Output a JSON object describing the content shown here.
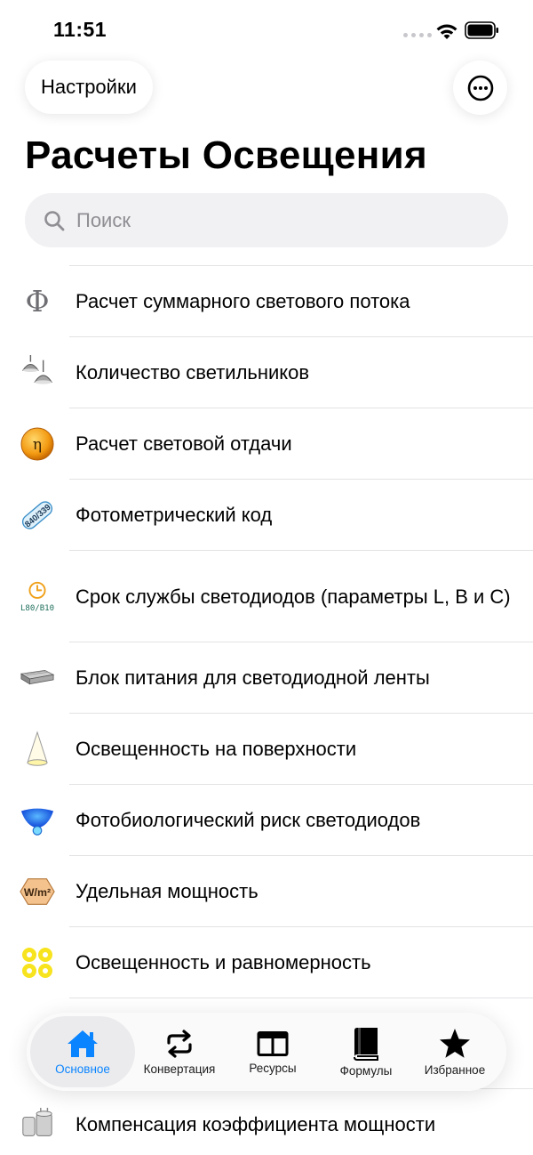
{
  "status_bar": {
    "time": "11:51"
  },
  "header": {
    "settings_label": "Настройки",
    "title": "Расчеты Освещения"
  },
  "search": {
    "placeholder": "Поиск"
  },
  "items": [
    {
      "label": "Расчет суммарного светового потока",
      "icon": "phi-icon"
    },
    {
      "label": "Количество светильников",
      "icon": "pendant-lamps-icon"
    },
    {
      "label": "Расчет световой отдачи",
      "icon": "eta-icon"
    },
    {
      "label": "Фотометрический код",
      "icon": "photometric-code-icon",
      "icon_text": "840/339"
    },
    {
      "label": "Срок службы светодиодов (параметры L, B и C)",
      "icon": "led-lifetime-icon",
      "icon_text": "L80/B10"
    },
    {
      "label": "Блок питания для светодиодной ленты",
      "icon": "power-supply-icon"
    },
    {
      "label": "Освещенность на поверхности",
      "icon": "light-cone-icon"
    },
    {
      "label": "Фотобиологический риск светодиодов",
      "icon": "blue-light-icon"
    },
    {
      "label": "Удельная мощность",
      "icon": "power-density-icon",
      "icon_text": "W/m²"
    },
    {
      "label": "Освещенность и равномерность",
      "icon": "uniformity-icon"
    },
    {
      "label": "Компенсация коэффициента мощности",
      "icon": "capacitor-icon"
    }
  ],
  "tabbar": {
    "tabs": [
      {
        "label": "Основное",
        "icon": "home-icon",
        "active": true
      },
      {
        "label": "Конвертация",
        "icon": "repeat-icon",
        "active": false
      },
      {
        "label": "Ресурсы",
        "icon": "layout-icon",
        "active": false
      },
      {
        "label": "Формулы",
        "icon": "book-icon",
        "active": false
      },
      {
        "label": "Избранное",
        "icon": "star-icon",
        "active": false
      }
    ]
  },
  "colors": {
    "accent": "#0a84ff",
    "separator": "#e3e3e6",
    "search_bg": "#f1f1f3"
  }
}
